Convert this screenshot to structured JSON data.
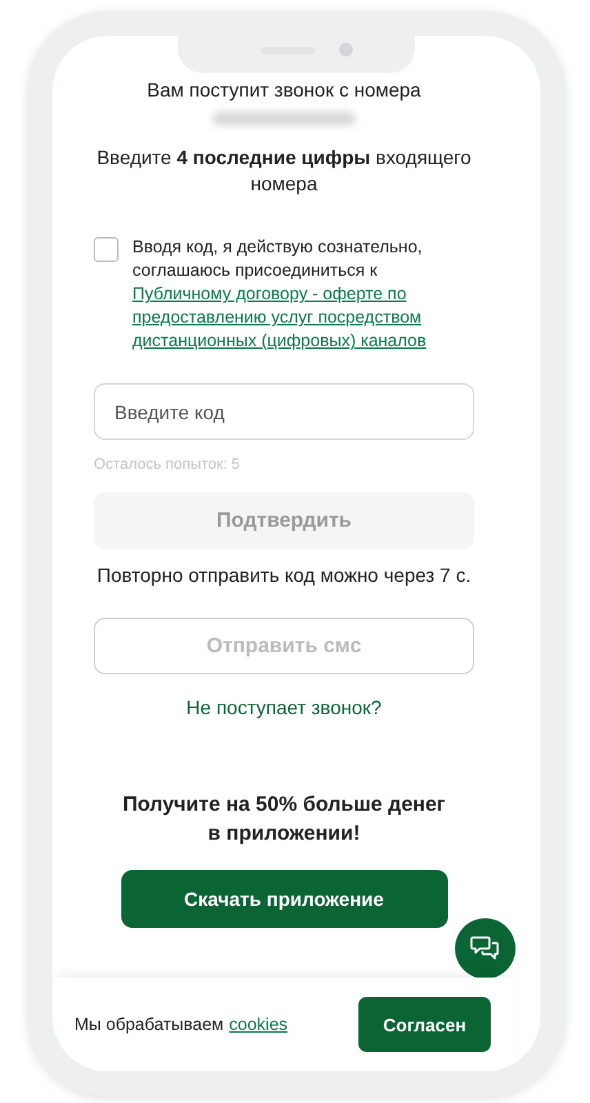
{
  "call_notice": {
    "title": "Вам поступит звонок с номера",
    "number_hidden": true
  },
  "instruction": "Введите **4 последние цифры** входящего номера",
  "consent": {
    "checked": false,
    "text": "Вводя код, я действую сознательно, соглашаюсь присоединиться к",
    "link": "Публичному договору - оферте по предоставлению услуг посредством дистанционных (цифровых) каналов"
  },
  "code_field": {
    "placeholder": "Введите код"
  },
  "attempts": "Осталось попыток: 5",
  "confirm_button": {
    "label": "Подтвердить",
    "disabled": true
  },
  "resend_note": "Повторно отправить код можно через 7 с.",
  "sms_button": {
    "label": "Отправить смс",
    "disabled": true
  },
  "no_call_link": "Не поступает звонок?",
  "promo": {
    "text": "Получите на 50% больше денег в приложении!",
    "button": "Скачать приложение"
  },
  "cookie_bar": {
    "text": "Мы обрабатываем",
    "link": "cookies",
    "button": "Согласен"
  }
}
